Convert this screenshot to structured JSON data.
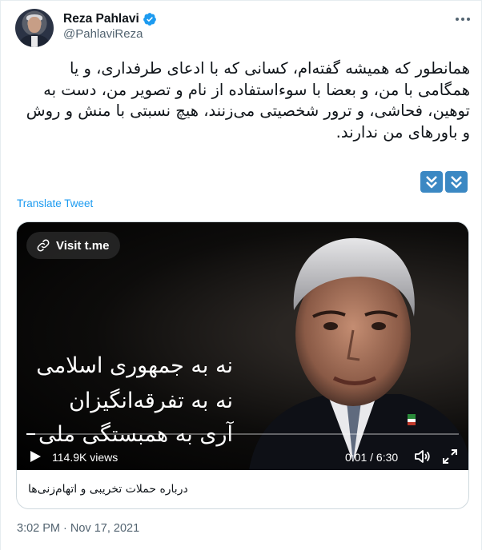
{
  "author": {
    "name": "Reza Pahlavi",
    "handle": "@PahlaviReza",
    "verified": true
  },
  "tweet": {
    "text": "همانطور که همیشه گفته‌ام، کسانی که با ادعای طرفداری، و یا همگامی با من، و بعضا با سوءاستفاده از نام و تصویر من، دست به توهین، فحاشی، و ترور شخصیتی می‌زنند، هیچ نسبتی با منش و روش و باورهای من ندارند.",
    "emoji_icons": [
      "double-down-arrow-icon",
      "double-down-arrow-icon"
    ],
    "translate_label": "Translate Tweet",
    "timestamp": "3:02 PM · Nov 17, 2021"
  },
  "video_card": {
    "visit_label": "Visit t.me",
    "overlay_lines": [
      "نه به جمهوری اسلامی",
      "نه به تفرقه‌انگیزان",
      "آری به همبستگی ملی"
    ],
    "views": "114.9K views",
    "time": "0:01 / 6:30",
    "progress": 0.003,
    "caption": "درباره حملات تخریبی و اتهام‌زنی‌ها"
  },
  "colors": {
    "accent": "#1d9bf0",
    "emoji_blue": "#3b88c3",
    "secondary_text": "#536471",
    "border": "#cfd9de"
  }
}
